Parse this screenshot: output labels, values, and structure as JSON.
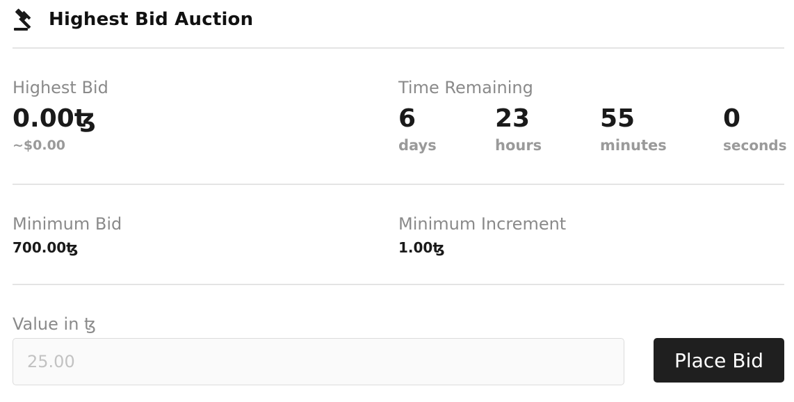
{
  "header": {
    "icon": "gavel-icon",
    "title": "Highest Bid Auction"
  },
  "highest_bid": {
    "label": "Highest Bid",
    "value": "0.00ꜩ",
    "usd": "~$0.00"
  },
  "time_remaining": {
    "label": "Time Remaining",
    "units": [
      {
        "value": "6",
        "unit": "days"
      },
      {
        "value": "23",
        "unit": "hours"
      },
      {
        "value": "55",
        "unit": "minutes"
      },
      {
        "value": "0",
        "unit": "seconds"
      }
    ]
  },
  "minimum_bid": {
    "label": "Minimum Bid",
    "value": "700.00ꜩ"
  },
  "minimum_increment": {
    "label": "Minimum Increment",
    "value": "1.00ꜩ"
  },
  "bid_form": {
    "label": "Value in ꜩ",
    "input_value": "",
    "placeholder": "25.00",
    "button_label": "Place Bid"
  },
  "colors": {
    "button_bg": "#1f1f1f",
    "label_gray": "#8a8a8a",
    "divider": "#e4e4e4"
  }
}
